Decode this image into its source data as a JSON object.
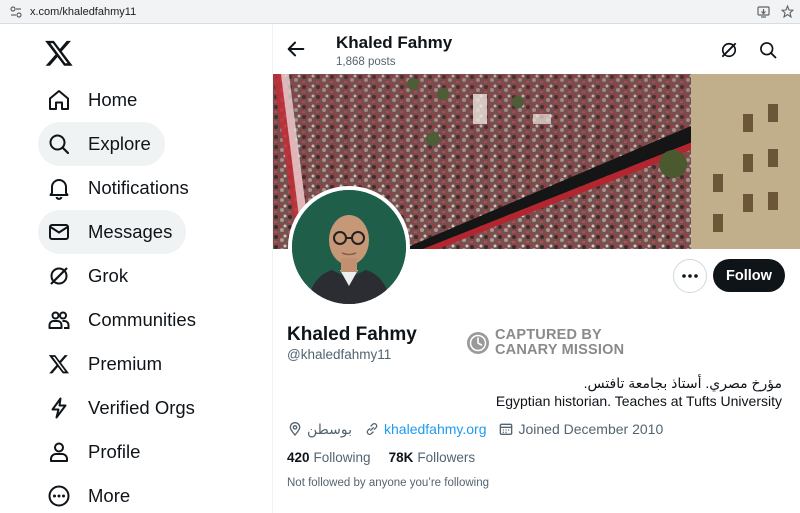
{
  "browser": {
    "url": "x.com/khaledfahmy11"
  },
  "nav": {
    "items": [
      {
        "label": "Home",
        "icon": "home-icon"
      },
      {
        "label": "Explore",
        "icon": "search-icon"
      },
      {
        "label": "Notifications",
        "icon": "bell-icon"
      },
      {
        "label": "Messages",
        "icon": "envelope-icon"
      },
      {
        "label": "Grok",
        "icon": "grok-icon"
      },
      {
        "label": "Communities",
        "icon": "communities-icon"
      },
      {
        "label": "Premium",
        "icon": "x-logo-icon"
      },
      {
        "label": "Verified Orgs",
        "icon": "lightning-icon"
      },
      {
        "label": "Profile",
        "icon": "person-icon"
      },
      {
        "label": "More",
        "icon": "more-circle-icon"
      }
    ]
  },
  "header": {
    "name": "Khaled Fahmy",
    "posts": "1,868 posts"
  },
  "profile": {
    "name": "Khaled Fahmy",
    "handle": "@khaledfahmy11",
    "watermark_line1": "CAPTURED BY",
    "watermark_line2": "CANARY MISSION",
    "bio_arabic": "مؤرخ مصري. أستاذ بجامعة تافتس.",
    "bio_english": "Egyptian historian. Teaches at Tufts University",
    "location": "بوسطن",
    "website": "khaledfahmy.org",
    "joined": "Joined December 2010",
    "following_count": "420",
    "following_label": "Following",
    "followers_count": "78K",
    "followers_label": "Followers",
    "not_followed": "Not followed by anyone you’re following",
    "follow_label": "Follow"
  },
  "colors": {
    "accent": "#1d9bf0",
    "text": "#0f1419",
    "muted": "#536471",
    "follow_bg": "#0f1419"
  }
}
